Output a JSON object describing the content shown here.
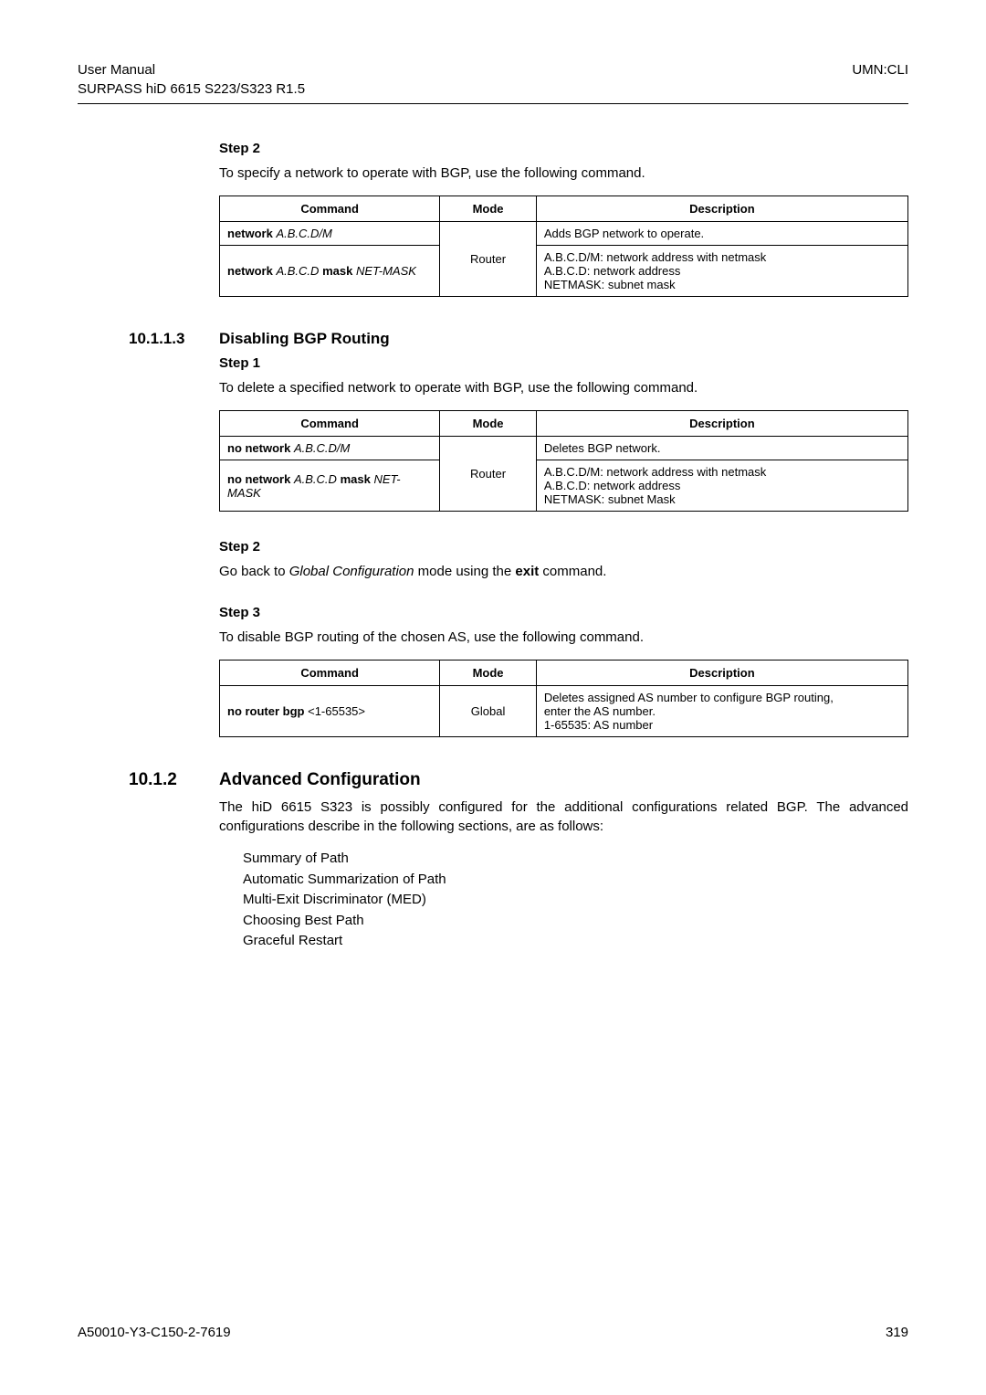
{
  "header": {
    "left_line1": "User Manual",
    "left_line2": "SURPASS hiD 6615 S223/S323 R1.5",
    "right": "UMN:CLI"
  },
  "s2_title": "Step 2",
  "s2_para": "To specify a network to operate with BGP, use the following command.",
  "t1": {
    "h_cmd": "Command",
    "h_mode": "Mode",
    "h_desc": "Description",
    "r1_cmd_bold": "network",
    "r1_cmd_italic": "A.B.C.D/M",
    "r1_desc": "Adds BGP network to operate.",
    "r2_cmd_bold1": "network",
    "r2_cmd_italic1": "A.B.C.D",
    "r2_cmd_bold2": "mask",
    "r2_cmd_italic2": "NET-MASK",
    "mode": "Router",
    "r2_desc_l1": "A.B.C.D/M: network address with netmask",
    "r2_desc_l2": "A.B.C.D: network address",
    "r2_desc_l3": "NETMASK: subnet mask"
  },
  "sec10113_num": "10.1.1.3",
  "sec10113_title": "Disabling BGP Routing",
  "step1_title": "Step 1",
  "step1_para": "To delete a specified network to operate with BGP, use the following command.",
  "t2": {
    "h_cmd": "Command",
    "h_mode": "Mode",
    "h_desc": "Description",
    "r1_cmd_bold": "no network",
    "r1_cmd_italic": "A.B.C.D/M",
    "r1_desc": "Deletes BGP network.",
    "r2_cmd_bold1": "no network",
    "r2_cmd_italic1": "A.B.C.D",
    "r2_cmd_bold2": "mask",
    "r2_cmd_italic2": "NET-MASK",
    "mode": "Router",
    "r2_desc_l1": "A.B.C.D/M: network address with netmask",
    "r2_desc_l2": "A.B.C.D: network address",
    "r2_desc_l3": "NETMASK: subnet Mask"
  },
  "step2b_title": "Step 2",
  "step2b_p1": "Go back to ",
  "step2b_italic": "Global Configuration",
  "step2b_p2": " mode using the ",
  "step2b_bold": "exit",
  "step2b_p3": " command.",
  "step3_title": "Step 3",
  "step3_para": "To disable BGP routing of the chosen AS, use the following command.",
  "t3": {
    "h_cmd": "Command",
    "h_mode": "Mode",
    "h_desc": "Description",
    "r1_cmd_bold": "no router bgp",
    "r1_cmd_rest": " <1-65535>",
    "mode": "Global",
    "r1_desc_l1": "Deletes assigned AS number to configure BGP routing,",
    "r1_desc_l2": "enter the AS number.",
    "r1_desc_l3": "1-65535: AS number"
  },
  "sec1012_num": "10.1.2",
  "sec1012_title": "Advanced Configuration",
  "sec1012_para": "The hiD 6615 S323 is possibly configured for the additional configurations related BGP. The advanced configurations describe in the following sections, are as follows:",
  "bullets": {
    "b1": "Summary of Path",
    "b2": "Automatic Summarization of Path",
    "b3": "Multi-Exit Discriminator (MED)",
    "b4": "Choosing Best Path",
    "b5": "Graceful Restart"
  },
  "footer": {
    "left": "A50010-Y3-C150-2-7619",
    "right": "319"
  }
}
